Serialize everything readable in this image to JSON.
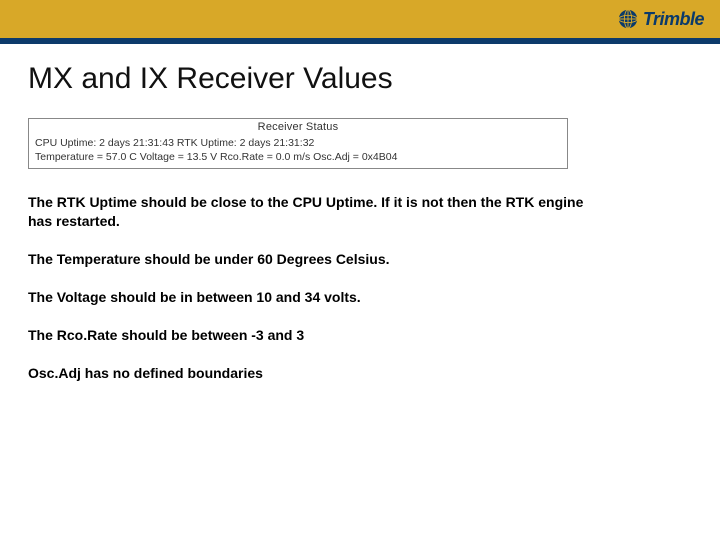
{
  "header": {
    "brand": "Trimble"
  },
  "title": "MX and IX Receiver Values",
  "status_box": {
    "heading": "Receiver Status",
    "line1": "CPU Uptime: 2 days 21:31:43    RTK Uptime: 2 days 21:31:32",
    "line2": "Temperature = 57.0 C    Voltage = 13.5 V    Rco.Rate = 0.0 m/s    Osc.Adj = 0x4B04"
  },
  "paragraphs": [
    "The RTK Uptime should be close to the CPU Uptime. If it is not then the RTK engine has restarted.",
    "The Temperature should be under 60 Degrees Celsius.",
    "The Voltage should be in between 10 and 34 volts.",
    "The Rco.Rate should be between -3 and 3",
    "Osc.Adj has no defined boundaries"
  ]
}
